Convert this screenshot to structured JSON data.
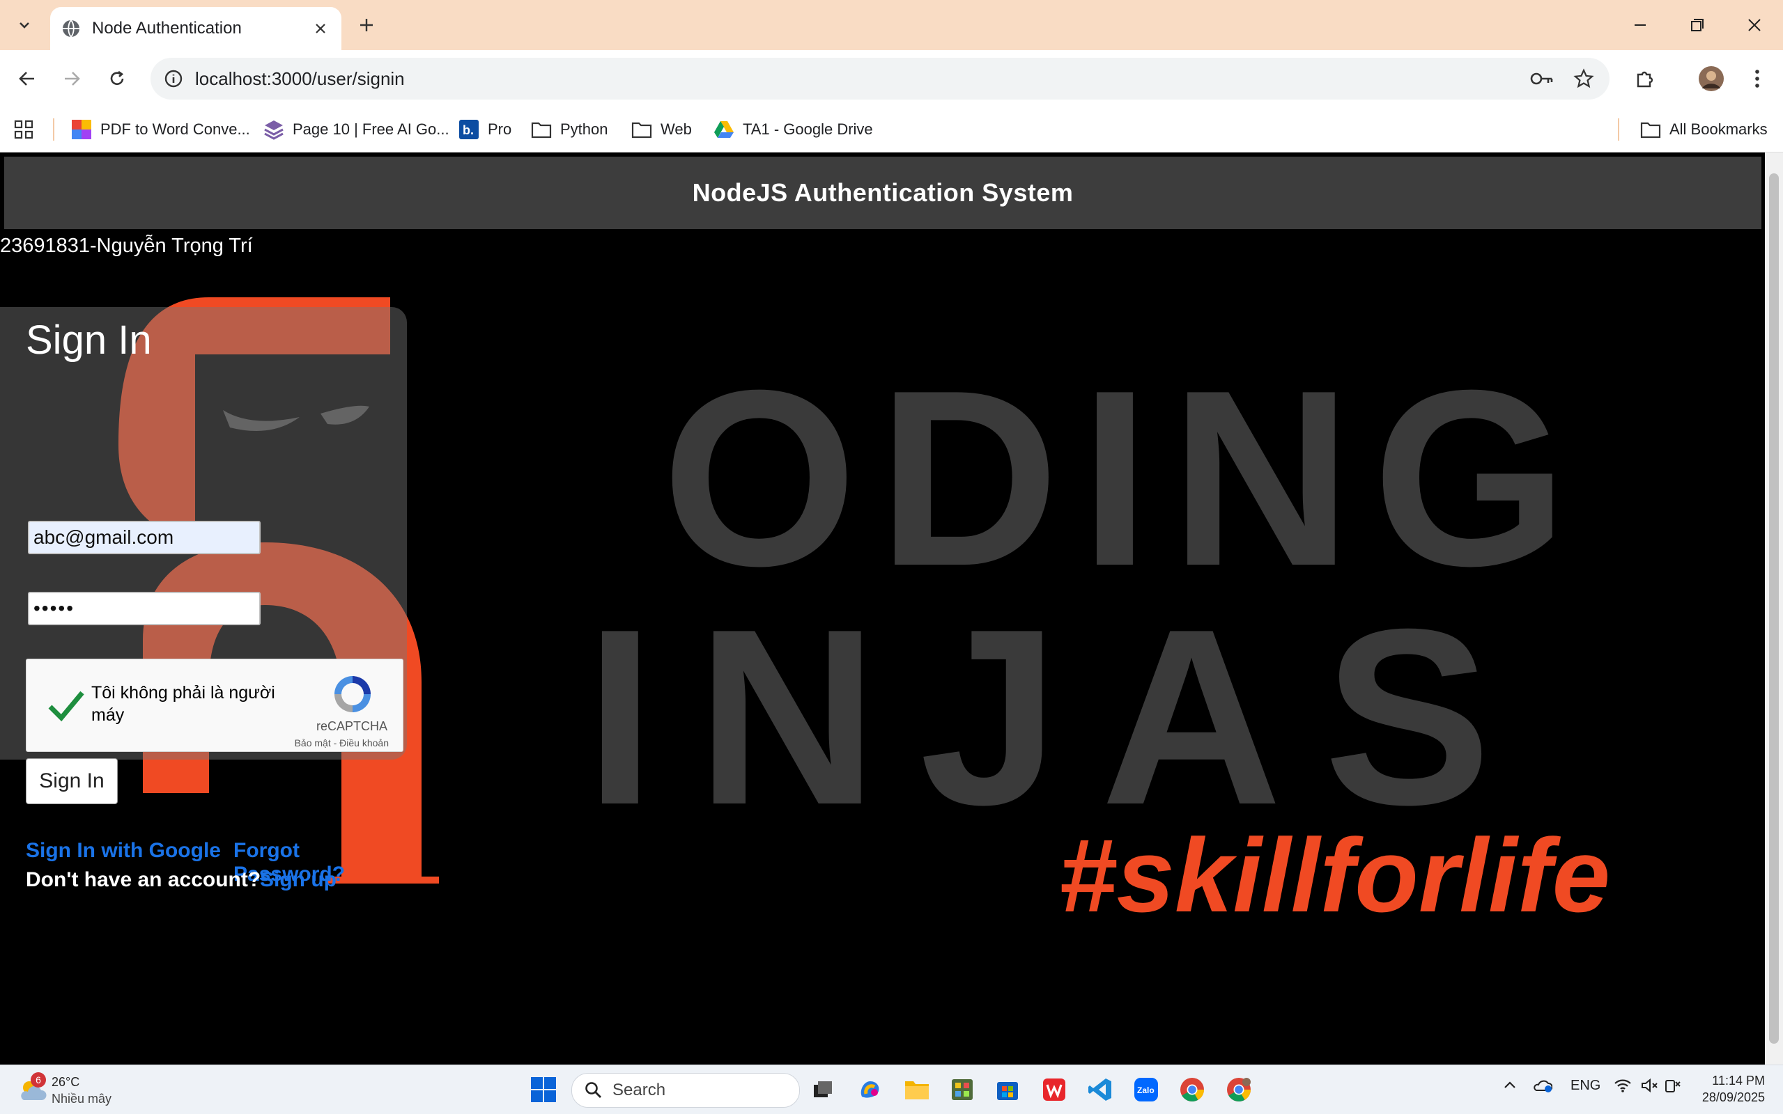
{
  "browser": {
    "tab_title": "Node Authentication",
    "url": "localhost:3000/user/signin",
    "bookmarks": [
      {
        "label": "PDF to Word Conve...",
        "icon": "pdf-app-icon"
      },
      {
        "label": "Page 10 | Free AI Go...",
        "icon": "ai-logo-icon"
      },
      {
        "label": "Pro",
        "icon": "booking-icon"
      },
      {
        "label": "Python",
        "icon": "folder-icon"
      },
      {
        "label": "Web",
        "icon": "folder-icon"
      },
      {
        "label": "TA1 - Google Drive",
        "icon": "google-drive-icon"
      }
    ],
    "all_bookmarks": "All Bookmarks"
  },
  "page": {
    "header_title": "NodeJS Authentication System",
    "student": "23691831-Nguyễn Trọng Trí",
    "background_text": {
      "line1": "ODING",
      "line2": "INJAS",
      "tagline": "#skillforlife"
    },
    "signin": {
      "title": "Sign In",
      "email_value": "abc@gmail.com",
      "password_value": "•••••",
      "captcha_label": "Tôi không phải là người máy",
      "captcha_brand": "reCAPTCHA",
      "captcha_terms": "Bảo mật - Điều khoản",
      "captcha_checked": true,
      "button": "Sign In",
      "google_link": "Sign In with Google",
      "forgot_link": "Forgot Password?",
      "no_account": "Don't have an account?",
      "signup_link": "Sign up"
    }
  },
  "taskbar": {
    "weather_temp": "26°C",
    "weather_cond": "Nhiều mây",
    "weather_badge": "6",
    "search_label": "Search",
    "lang": "ENG",
    "time": "11:14 PM",
    "date": "28/09/2025"
  },
  "colors": {
    "tabstrip": "#f9dcc4",
    "page_header": "#3d3d3d",
    "link": "#1a73e8",
    "coding_ninjas_orange": "#f04a23",
    "bg_letters": "#3a3a3a"
  }
}
